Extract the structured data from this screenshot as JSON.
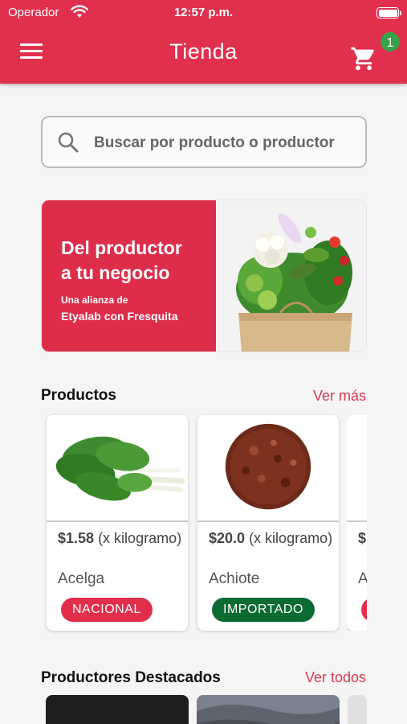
{
  "status_bar": {
    "carrier": "Operador",
    "time": "12:57 p.m."
  },
  "app_bar": {
    "title": "Tienda",
    "cart_count": "1"
  },
  "search": {
    "placeholder": "Buscar por producto o productor"
  },
  "banner": {
    "line1": "Del productor",
    "line2": "a tu negocio",
    "sub1": "Una alianza de",
    "sub2": "Etyalab con Fresquita"
  },
  "products_section": {
    "title": "Productos",
    "link": "Ver más",
    "items": [
      {
        "price": "$1.58",
        "unit": "(x kilogramo)",
        "name": "Acelga",
        "tag": "NACIONAL"
      },
      {
        "price": "$20.0",
        "unit": "(x kilogramo)",
        "name": "Achiote",
        "tag": "IMPORTADO"
      },
      {
        "price": "$",
        "name": "A"
      }
    ]
  },
  "producers_section": {
    "title": "Productores Destacados",
    "link": "Ver todos"
  },
  "colors": {
    "primary": "#e0304e",
    "badge": "#3aa14a",
    "tag_national": "#e02e4b",
    "tag_imported": "#0c6b33"
  },
  "icons": {
    "menu": "hamburger-icon",
    "cart": "cart-icon",
    "search": "search-icon",
    "wifi": "wifi-icon",
    "battery": "battery-icon"
  }
}
